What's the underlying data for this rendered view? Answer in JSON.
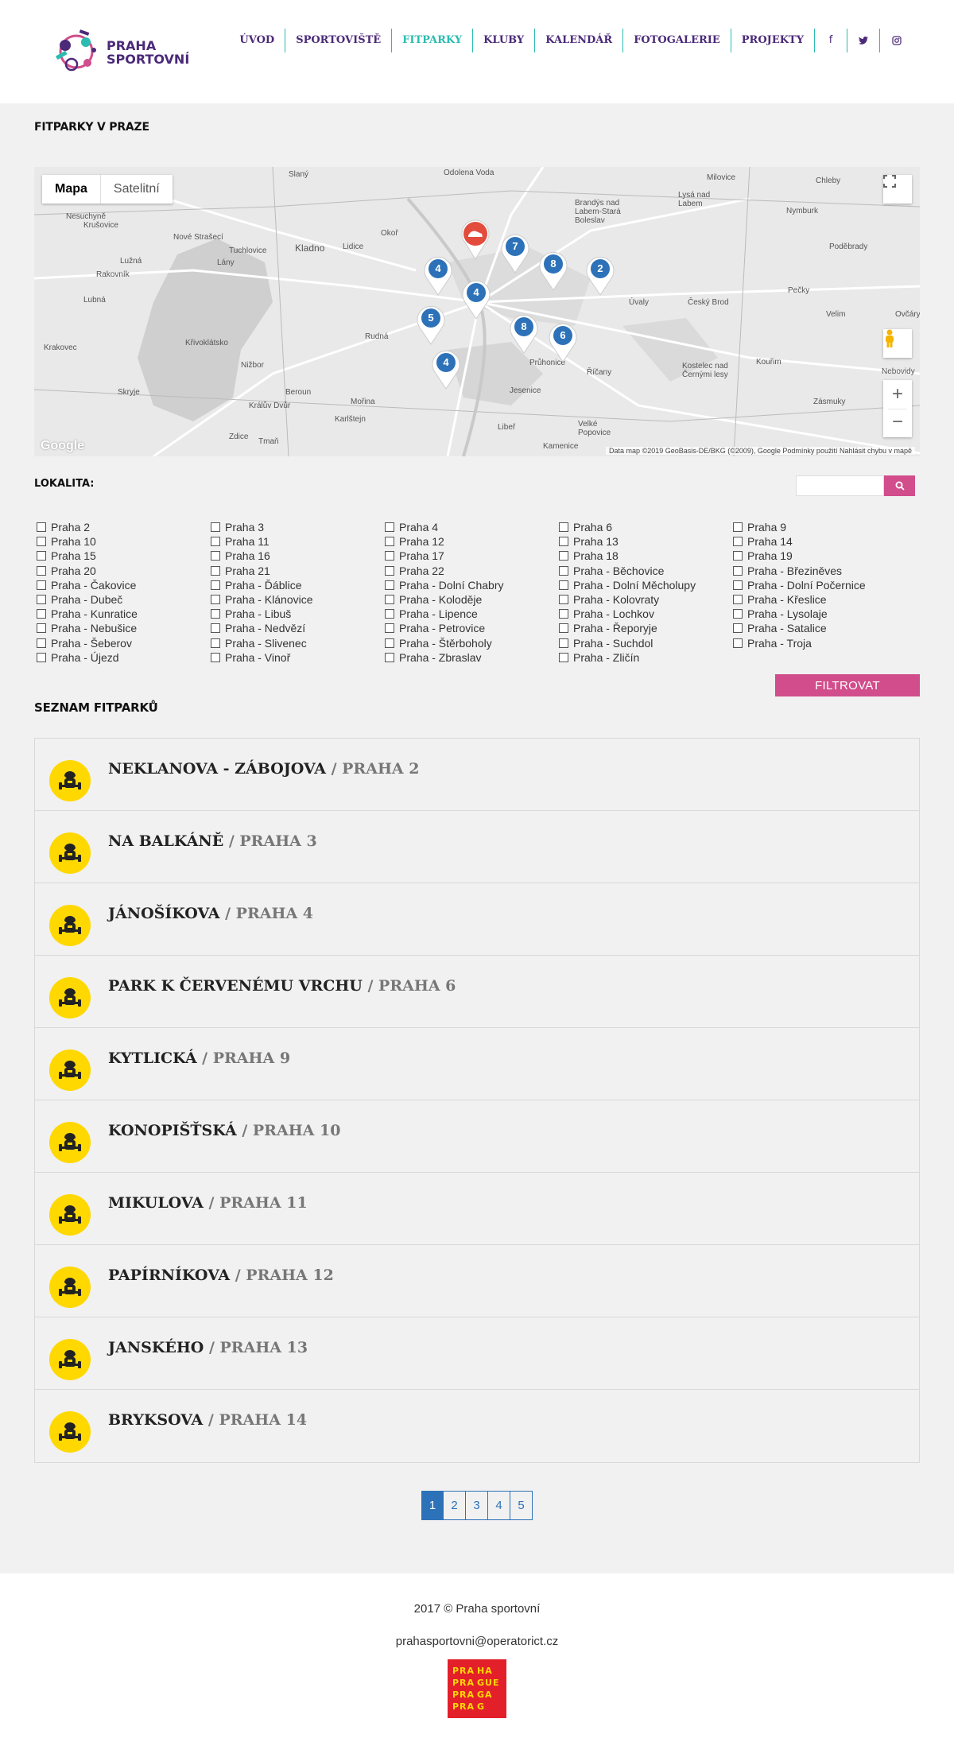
{
  "header": {
    "logo": {
      "line1": "PRAHA",
      "line2": "SPORTOVNÍ"
    },
    "nav": [
      {
        "label": "ÚVOD",
        "active": false
      },
      {
        "label": "SPORTOVIŠTĚ",
        "active": false
      },
      {
        "label": "FITPARKY",
        "active": true
      },
      {
        "label": "KLUBY",
        "active": false
      },
      {
        "label": "KALENDÁŘ",
        "active": false
      },
      {
        "label": "FOTOGALERIE",
        "active": false
      },
      {
        "label": "PROJEKTY",
        "active": false
      }
    ],
    "social": [
      {
        "icon": "facebook-icon",
        "glyph": "f"
      },
      {
        "icon": "twitter-icon",
        "glyph": "t"
      },
      {
        "icon": "instagram-icon",
        "glyph": "◎"
      }
    ]
  },
  "map_section": {
    "title": "FITPARKY V PRAZE",
    "tabs": [
      "Mapa",
      "Satelitní"
    ],
    "attribution": "Data map ©2019 GeoBasis-DE/BKG (©2009), Google   Podmínky použití   Nahlásit chybu v mapě",
    "google_label": "Google",
    "clusters": [
      "4",
      "7",
      "8",
      "2",
      "4",
      "5",
      "8",
      "6",
      "4"
    ],
    "places": [
      "Slaný",
      "Nové Strašecí",
      "Kladno",
      "Lidice",
      "Okoř",
      "Odolena Voda",
      "Milovice",
      "Chleby",
      "Brandýs nad Labem-Stará Boleslav",
      "Lysá nad Labem",
      "Nymburk",
      "Poděbrady",
      "Úvaly",
      "Český Brod",
      "Pečky",
      "Velim",
      "Kouřim",
      "Kostelec nad Černými lesy",
      "Zásmuky",
      "Říčany",
      "Průhonice",
      "Jesenice",
      "Velké Popovice",
      "Kamenice",
      "Libeř",
      "Mořina",
      "Karlštejn",
      "Beroun",
      "Křivoklátsko",
      "Nižbor",
      "Skryje",
      "Králův Dvůr",
      "Zdice",
      "Tmaň",
      "Rakovník",
      "Lužná",
      "Lubná",
      "Krakovec",
      "Nesuchyně",
      "Krušovice",
      "Tuchlovice",
      "Lány",
      "Rudná",
      "Ovčáry",
      "Nebovidy"
    ]
  },
  "filter": {
    "label": "LOKALITA:",
    "search_placeholder": "",
    "button": "FILTROVAT",
    "columns": [
      [
        "Praha 2",
        "Praha 10",
        "Praha 15",
        "Praha 20",
        "Praha - Čakovice",
        "Praha - Dubeč",
        "Praha - Kunratice",
        "Praha - Nebušice",
        "Praha - Šeberov",
        "Praha - Újezd"
      ],
      [
        "Praha 3",
        "Praha 11",
        "Praha 16",
        "Praha 21",
        "Praha - Ďáblice",
        "Praha - Klánovice",
        "Praha - Libuš",
        "Praha - Nedvězí",
        "Praha - Slivenec",
        "Praha - Vinoř"
      ],
      [
        "Praha 4",
        "Praha 12",
        "Praha 17",
        "Praha 22",
        "Praha - Dolní Chabry",
        "Praha - Koloděje",
        "Praha - Lipence",
        "Praha - Petrovice",
        "Praha - Štěrboholy",
        "Praha - Zbraslav"
      ],
      [
        "Praha 6",
        "Praha 13",
        "Praha 18",
        "Praha - Běchovice",
        "Praha - Dolní Měcholupy",
        "Praha - Kolovraty",
        "Praha - Lochkov",
        "Praha - Řeporyje",
        "Praha - Suchdol",
        "Praha - Zličín"
      ],
      [
        "Praha 9",
        "Praha 14",
        "Praha 19",
        "Praha - Březiněves",
        "Praha - Dolní Počernice",
        "Praha - Křeslice",
        "Praha - Lysolaje",
        "Praha - Satalice",
        "Praha - Troja"
      ]
    ]
  },
  "list_section": {
    "title": "SEZNAM FITPARKŮ",
    "items": [
      {
        "name": "NEKLANOVA - ZÁBOJOVA",
        "sep": " / ",
        "district": "PRAHA 2"
      },
      {
        "name": "NA BALKÁNĚ",
        "sep": " / ",
        "district": "PRAHA 3"
      },
      {
        "name": "JÁNOŠÍKOVA",
        "sep": " / ",
        "district": "PRAHA 4"
      },
      {
        "name": "PARK K ČERVENÉMU VRCHU",
        "sep": " / ",
        "district": "PRAHA 6"
      },
      {
        "name": "KYTLICKÁ",
        "sep": " / ",
        "district": "PRAHA 9"
      },
      {
        "name": "KONOPIŠŤSKÁ",
        "sep": " / ",
        "district": "PRAHA 10"
      },
      {
        "name": "MIKULOVA",
        "sep": " / ",
        "district": "PRAHA 11"
      },
      {
        "name": "PAPÍRNÍKOVA",
        "sep": " / ",
        "district": "PRAHA 12"
      },
      {
        "name": "JANSKÉHO",
        "sep": " / ",
        "district": "PRAHA 13"
      },
      {
        "name": "BRYKSOVA",
        "sep": " / ",
        "district": "PRAHA 14"
      }
    ]
  },
  "pagination": {
    "pages": [
      "1",
      "2",
      "3",
      "4",
      "5"
    ],
    "current": "1"
  },
  "footer": {
    "copyright": "2017 © Praha sportovní",
    "email": "prahasportovni@operatorict.cz",
    "prague_logo": [
      "PRA",
      "HA",
      "PRA",
      "GUE",
      "PRA",
      "GA",
      "PRA",
      "G"
    ]
  },
  "colors": {
    "purple": "#4b2a78",
    "teal": "#2bbcb1",
    "pink": "#d14d8b",
    "blue": "#2d72b8",
    "yellow": "#ffd800",
    "red": "#e3202a"
  }
}
